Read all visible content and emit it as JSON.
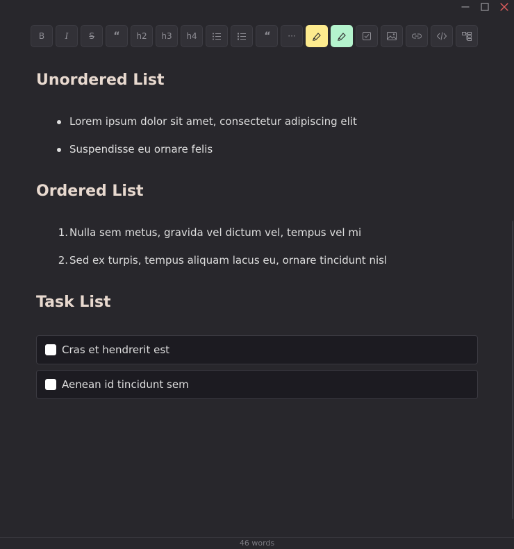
{
  "window": {
    "controls": [
      "minimize-icon",
      "maximize-icon",
      "close-icon"
    ],
    "close_color": "#e05d5d"
  },
  "toolbar": {
    "buttons": [
      {
        "name": "bold",
        "label": "B",
        "icon": "bold-icon"
      },
      {
        "name": "italic",
        "label": "I",
        "icon": "italic-icon"
      },
      {
        "name": "strikethrough",
        "label": "S",
        "icon": "strikethrough-icon"
      },
      {
        "name": "quote-mark",
        "label": "“",
        "icon": "quote-mark-icon"
      },
      {
        "name": "h2",
        "label": "h2"
      },
      {
        "name": "h3",
        "label": "h3"
      },
      {
        "name": "h4",
        "label": "h4"
      },
      {
        "name": "unordered-list",
        "icon": "bulleted-list-icon"
      },
      {
        "name": "ordered-list",
        "icon": "numbered-list-icon"
      },
      {
        "name": "blockquote",
        "label": "“",
        "icon": "blockquote-icon"
      },
      {
        "name": "horizontal-rule",
        "label": "···",
        "icon": "ellipsis-icon"
      },
      {
        "name": "highlight-yellow",
        "icon": "highlighter-icon",
        "color": "#fdeb8e"
      },
      {
        "name": "highlight-green",
        "icon": "highlighter-icon",
        "color": "#b4f3cd"
      },
      {
        "name": "task",
        "icon": "checkbox-icon"
      },
      {
        "name": "image",
        "icon": "image-icon"
      },
      {
        "name": "link",
        "icon": "link-icon"
      },
      {
        "name": "code",
        "icon": "code-icon"
      },
      {
        "name": "table",
        "icon": "hierarchy-icon"
      }
    ]
  },
  "document": {
    "unordered": {
      "heading": "Unordered List",
      "items": [
        "Lorem ipsum dolor sit amet, consectetur adipiscing elit",
        "Suspendisse eu ornare felis"
      ]
    },
    "ordered": {
      "heading": "Ordered List",
      "items": [
        "Nulla sem metus, gravida vel dictum vel, tempus vel mi",
        "Sed ex turpis, tempus aliquam lacus eu, ornare tincidunt nisl"
      ],
      "numbers": [
        "1.",
        "2."
      ]
    },
    "tasks": {
      "heading": "Task List",
      "items": [
        {
          "label": "Cras et hendrerit est",
          "checked": false
        },
        {
          "label": "Aenean id tincidunt sem",
          "checked": false
        }
      ]
    }
  },
  "status": {
    "word_count": "46 words"
  },
  "colors": {
    "background": "#28272c",
    "heading": "#e8d9cf",
    "task_bg": "#1c1b21"
  }
}
